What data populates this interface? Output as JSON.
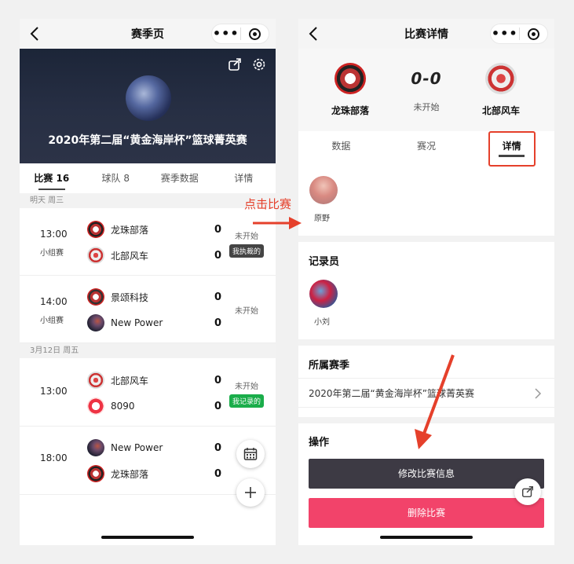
{
  "left": {
    "nav_title": "赛季页",
    "banner_title": "2020年第二届“黄金海岸杯”篮球菁英赛",
    "tabs": [
      {
        "label": "比赛 16",
        "active": true
      },
      {
        "label": "球队 8",
        "active": false
      },
      {
        "label": "赛季数据",
        "active": false
      },
      {
        "label": "详情",
        "active": false
      }
    ],
    "dates": [
      "明天 周三",
      "3月12日 周五"
    ],
    "matches": [
      {
        "time": "13:00",
        "group": "小组赛",
        "team1": "龙珠部落",
        "score1": "0",
        "team2": "北部风车",
        "score2": "0",
        "status": "未开始",
        "badge": "我执裁的",
        "badge_color": "#444444"
      },
      {
        "time": "14:00",
        "group": "小组赛",
        "team1": "景颂科技",
        "score1": "0",
        "team2": "New Power",
        "score2": "0",
        "status": "未开始",
        "badge": "",
        "badge_color": ""
      },
      {
        "time": "13:00",
        "group": "",
        "team1": "北部风车",
        "score1": "0",
        "team2": "8090",
        "score2": "0",
        "status": "未开始",
        "badge": "我记录的",
        "badge_color": "#1aad4a"
      },
      {
        "time": "18:00",
        "group": "",
        "team1": "New Power",
        "score1": "0",
        "team2": "龙珠部落",
        "score2": "0",
        "status": "",
        "badge": "",
        "badge_color": ""
      }
    ]
  },
  "annotation": {
    "label": "点击比赛",
    "color": "#e5402b"
  },
  "right": {
    "nav_title": "比赛详情",
    "home_team": "龙珠部落",
    "away_team": "北部风车",
    "score": "0-0",
    "status": "未开始",
    "tabs": [
      {
        "label": "数据",
        "active": false
      },
      {
        "label": "赛况",
        "active": false
      },
      {
        "label": "详情",
        "active": true
      }
    ],
    "referee_name": "原野",
    "recorder_title": "记录员",
    "recorder_name": "小刘",
    "season_title": "所属赛季",
    "season_name": "2020年第二届“黄金海岸杯”篮球菁英赛",
    "ops_title": "操作",
    "edit_button": "修改比赛信息",
    "delete_button": "删除比赛"
  },
  "icons": [
    "back-icon",
    "more-icon",
    "target-icon",
    "share-icon",
    "settings-icon",
    "calendar-icon",
    "plus-icon",
    "chevron-right-icon"
  ]
}
